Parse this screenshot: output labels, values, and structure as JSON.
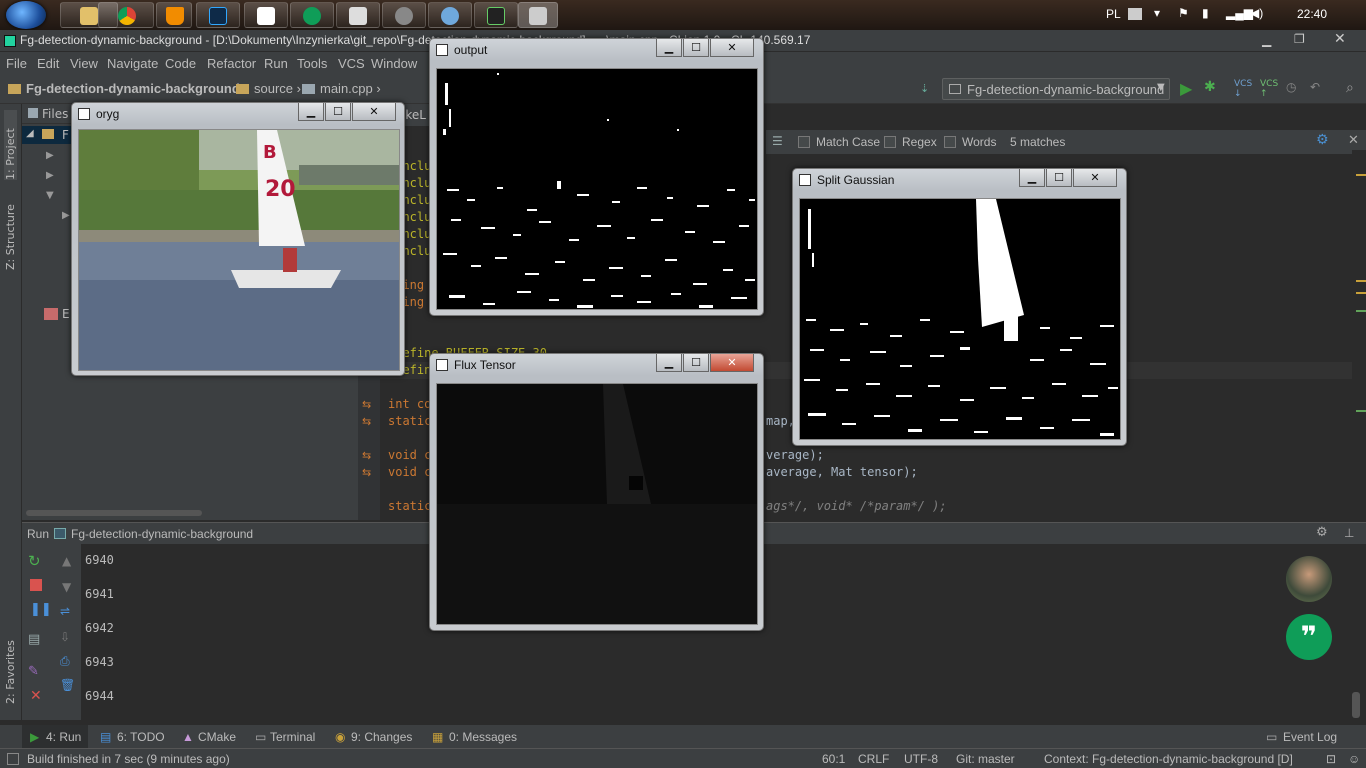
{
  "taskbar": {
    "language": "PL",
    "clock": "22:40"
  },
  "ide": {
    "window_title": "Fg-detection-dynamic-background - [D:\\Dokumenty\\Inzynierka\\git_repo\\Fg-detection-dynamic-background] - ...\\main.cpp - CLion 1.0 - CL-140.569.17",
    "menu": [
      "File",
      "Edit",
      "View",
      "Navigate",
      "Code",
      "Refactor",
      "Run",
      "Tools",
      "VCS",
      "Window"
    ],
    "breadcrumb": [
      "Fg-detection-dynamic-background",
      "source",
      "main.cpp"
    ],
    "run_config": "Fg-detection-dynamic-background",
    "left_tabs": [
      "1: Project",
      "Z: Structure",
      "2: Favorites"
    ],
    "project_header": "Files",
    "project_items": [
      "F",
      "E"
    ],
    "editor_tab": "akeL",
    "find": {
      "match_case": "Match Case",
      "regex": "Regex",
      "words": "Words",
      "matches": "5 matches"
    },
    "code_lines": [
      "#inclu",
      "#inclu",
      "#inclu",
      "#inclu",
      "#inclu",
      "#inclu",
      "",
      "using",
      "using",
      "",
      "",
      "#define BUFFER_SIZE 30",
      "#defin",
      "",
      "int co",
      "static",
      "",
      "void c",
      "void c",
      "",
      "static"
    ],
    "code_tail": [
      {
        "line": 15,
        "text": "map,"
      },
      {
        "line": 17,
        "text": "verage);"
      },
      {
        "line": 18,
        "text": "average, Mat tensor);"
      },
      {
        "line": 20,
        "text": "ags*/, void* /*param*/ );"
      }
    ],
    "run_panel": {
      "title": "Run",
      "config": "Fg-detection-dynamic-background",
      "output": [
        "6940",
        "6941",
        "6942",
        "6943",
        "6944"
      ]
    },
    "bottom_tabs": [
      "4: Run",
      "6: TODO",
      "CMake",
      "Terminal",
      "9: Changes",
      "0: Messages",
      "Event Log"
    ],
    "status": {
      "message": "Build finished in 7 sec (9 minutes ago)",
      "position": "60:1",
      "line_sep": "CRLF",
      "encoding": "UTF-8",
      "git": "Git: master",
      "context": "Context: Fg-detection-dynamic-background [D]"
    }
  },
  "windows": {
    "oryg": "oryg",
    "output": "output",
    "flux": "Flux Tensor",
    "gaussian": "Split Gaussian"
  },
  "colors": {
    "ide_bg": "#2b2b2b",
    "panel_bg": "#3c3f41",
    "run_green": "#3b9a3b",
    "hangouts_green": "#0f9d58"
  }
}
